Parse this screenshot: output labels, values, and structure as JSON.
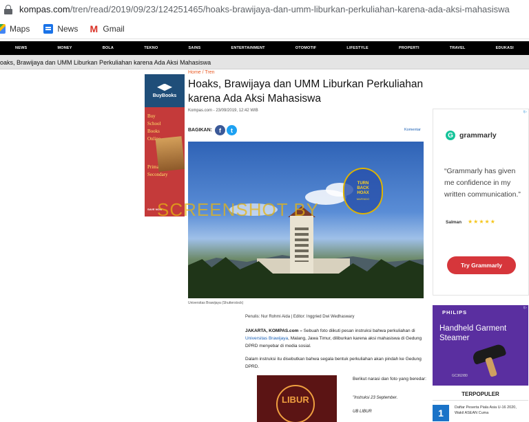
{
  "browser": {
    "url_domain": "kompas.com",
    "url_path": "/tren/read/2019/09/23/124251465/hoaks-brawijaya-dan-umm-liburkan-perkuliahan-karena-ada-aksi-mahasiswa",
    "bookmarks": [
      {
        "label": "Maps",
        "icon": "maps-icon"
      },
      {
        "label": "News",
        "icon": "news-icon"
      },
      {
        "label": "Gmail",
        "icon": "gmail-icon",
        "glyph": "M"
      }
    ]
  },
  "nav": {
    "items": [
      "NEWS",
      "MONEY",
      "BOLA",
      "TEKNO",
      "SAINS",
      "ENTERTAINMENT",
      "OTOMOTIF",
      "LIFESTYLE",
      "PROPERTI",
      "TRAVEL",
      "EDUKASI"
    ]
  },
  "crumbbar": {
    "text": "oaks, Brawijaya dan UMM Liburkan Perkuliahan karena Ada Aksi Mahasiswa"
  },
  "ad_left": {
    "brand": "BuyBooks",
    "line1": "Buy",
    "line2": "School",
    "line3": "Books",
    "line4": "Online",
    "line5": "Primary &",
    "line6": "Secondary",
    "cta": "SAVE NOW"
  },
  "article": {
    "breadcrumb": "Home / Tren",
    "title": "Hoaks, Brawijaya dan UMM Liburkan Perkuliahan karena Ada Aksi Mahasiswa",
    "meta": "Kompas.com - 23/09/2019, 12:42 WIB",
    "share_label": "BAGIKAN:",
    "comment_label": "Komentar",
    "photo_caption": "Universitas Brawijaya (Shutterstock)",
    "stamp_line1": "TURN",
    "stamp_line2": "BACK",
    "stamp_line3": "HOAX",
    "stamp_sub": "MAFINDO",
    "watermark": "SCREENSHOT BY",
    "byline": "Penulis: Nur Rohmi Aida | Editor: Inggried Dwi Wedhaswary",
    "p1_lead": "JAKARTA, KOMPAS.com –",
    "p1_a": " Sebuah foto diikuti pesan instruksi bahwa perkuliahan di ",
    "p1_link": "Universitas Brawijaya",
    "p1_b": ", Malang, Jawa Timur, diliburkan karena aksi mahasiswa di Gedung DPRD menyebar di media sosial.",
    "p2": "Dalam instruksi itu disebutkan bahwa segala bentuk perkuliahan akan pindah ke Gedung DPRD.",
    "inset_text": "LIBUR",
    "quote1": "Berikut narasi dan foto yang beredar:",
    "quote2": "\"Instruksi 23 September.",
    "quote3": "UB LIBUR"
  },
  "ad_grammarly": {
    "badge": "i▷",
    "logo_glyph": "G",
    "brand": "grammarly",
    "quote": "“Grammarly has given me confidence in my written communication.”",
    "user": "Salman",
    "stars": "★★★★★",
    "cta": "Try Grammarly"
  },
  "ad_philips": {
    "badge": "i▷",
    "brand": "PHILIPS",
    "title": "Handheld Garment Steamer",
    "model": "GC362/80"
  },
  "terpopuler": {
    "heading": "TERPOPULER",
    "items": [
      {
        "num": "1",
        "text": "Daftar Peserta Piala Asia U-16 2020, Wakil ASEAN Cuma"
      }
    ]
  },
  "colors": {
    "nav_bg": "#000000",
    "accent_orange": "#e85a24",
    "grammarly_red": "#d6363b",
    "philips_purple": "#5a2fa0",
    "terpop_blue": "#1a73c8"
  }
}
